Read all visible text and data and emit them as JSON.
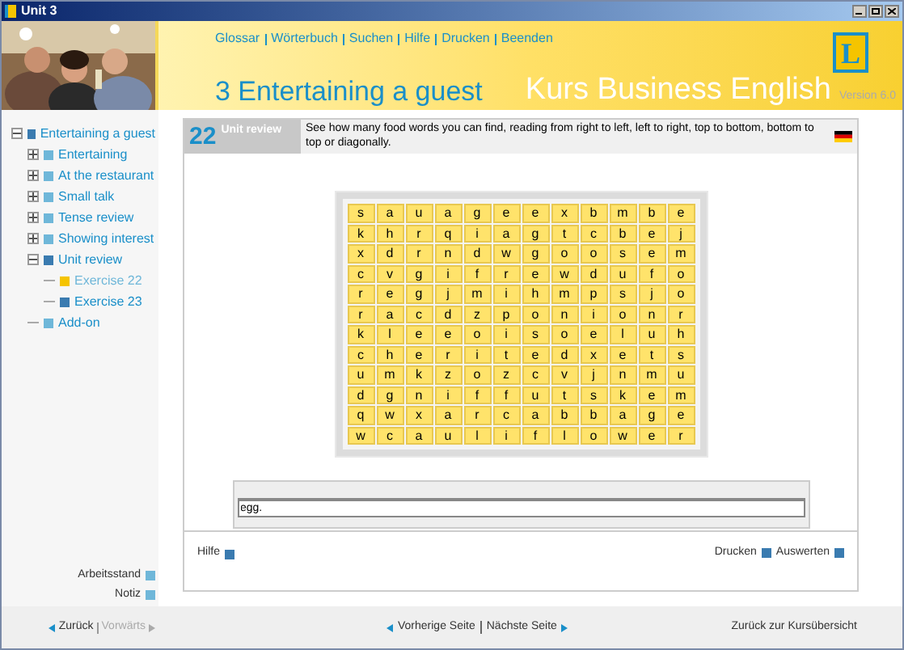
{
  "window": {
    "title": "Unit 3"
  },
  "top_links": [
    "Glossar",
    "Wörterbuch",
    "Suchen",
    "Hilfe",
    "Drucken",
    "Beenden"
  ],
  "unit_title": "3 Entertaining a guest",
  "course_title": "Kurs Business English",
  "version": "Version 6.0",
  "logo_letter": "L",
  "tree": [
    {
      "label": "Entertaining a guest",
      "expanded": true,
      "selected": false,
      "children": [
        {
          "label": "Entertaining",
          "expanded": false,
          "selected": false
        },
        {
          "label": "At the restaurant",
          "expanded": false,
          "selected": false
        },
        {
          "label": "Small talk",
          "expanded": false,
          "selected": false
        },
        {
          "label": "Tense review",
          "expanded": false,
          "selected": false
        },
        {
          "label": "Showing interest",
          "expanded": false,
          "selected": false
        },
        {
          "label": "Unit review",
          "expanded": true,
          "selected": false,
          "children": [
            {
              "label": "Exercise 22",
              "selected": true
            },
            {
              "label": "Exercise 23",
              "selected": false
            }
          ]
        },
        {
          "label": "Add-on",
          "selected": false
        }
      ]
    }
  ],
  "exercise": {
    "number": "22",
    "section": "Unit review",
    "instruction": "See how many food words you can find, reading from right to left, left to right, top to bottom, bottom to top or diagonally.",
    "grid": [
      [
        "s",
        "a",
        "u",
        "a",
        "g",
        "e",
        "e",
        "x",
        "b",
        "m",
        "b",
        "e"
      ],
      [
        "k",
        "h",
        "r",
        "q",
        "i",
        "a",
        "g",
        "t",
        "c",
        "b",
        "e",
        "j"
      ],
      [
        "x",
        "d",
        "r",
        "n",
        "d",
        "w",
        "g",
        "o",
        "o",
        "s",
        "e",
        "m"
      ],
      [
        "c",
        "v",
        "g",
        "i",
        "f",
        "r",
        "e",
        "w",
        "d",
        "u",
        "f",
        "o"
      ],
      [
        "r",
        "e",
        "g",
        "j",
        "m",
        "i",
        "h",
        "m",
        "p",
        "s",
        "j",
        "o"
      ],
      [
        "r",
        "a",
        "c",
        "d",
        "z",
        "p",
        "o",
        "n",
        "i",
        "o",
        "n",
        "r"
      ],
      [
        "k",
        "l",
        "e",
        "e",
        "o",
        "i",
        "s",
        "o",
        "e",
        "l",
        "u",
        "h"
      ],
      [
        "c",
        "h",
        "e",
        "r",
        "i",
        "t",
        "e",
        "d",
        "x",
        "e",
        "t",
        "s"
      ],
      [
        "u",
        "m",
        "k",
        "z",
        "o",
        "z",
        "c",
        "v",
        "j",
        "n",
        "m",
        "u"
      ],
      [
        "d",
        "g",
        "n",
        "i",
        "f",
        "f",
        "u",
        "t",
        "s",
        "k",
        "e",
        "m"
      ],
      [
        "q",
        "w",
        "x",
        "a",
        "r",
        "c",
        "a",
        "b",
        "b",
        "a",
        "g",
        "e"
      ],
      [
        "w",
        "c",
        "a",
        "u",
        "l",
        "i",
        "f",
        "l",
        "o",
        "w",
        "e",
        "r"
      ]
    ],
    "answer": "egg.",
    "help": "Hilfe",
    "actions": [
      "Drucken",
      "Auswerten"
    ]
  },
  "side_links": [
    "Arbeitsstand",
    "Notiz"
  ],
  "nav": {
    "back": "Zurück",
    "forward": "Vorwärts",
    "forward_disabled": true,
    "previous_page": "Vorherige Seite",
    "next_page": "Nächste Seite",
    "overview": "Zurück zur Kursübersicht"
  }
}
